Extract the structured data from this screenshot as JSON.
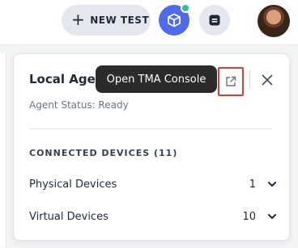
{
  "topbar": {
    "new_test_label": "NEW TEST",
    "agent_button_icon": "cube-icon",
    "agent_status_dot_color": "#2fbf9e",
    "logs_button_icon": "console-icon"
  },
  "panel": {
    "title": "Local Agent",
    "agent_status": "Agent Status: Ready",
    "tooltip": "Open TMA Console",
    "devices_heading": "CONNECTED DEVICES (11)",
    "devices": [
      {
        "label": "Physical Devices",
        "count": "1"
      },
      {
        "label": "Virtual Devices",
        "count": "10"
      }
    ]
  },
  "colors": {
    "accent": "#4f6bed",
    "highlight_border": "#e53935"
  }
}
